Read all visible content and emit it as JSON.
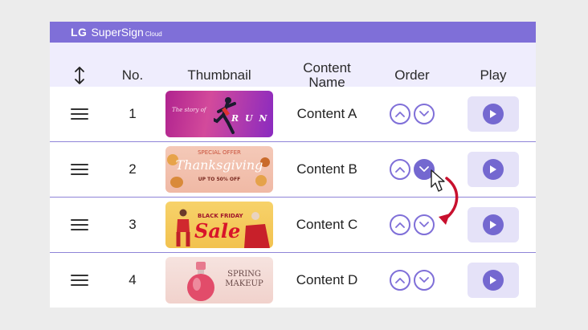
{
  "brand": {
    "logo": "LG",
    "name": "SuperSign",
    "suffix": "Cloud"
  },
  "table": {
    "headers": {
      "sort": "sort-arrows-icon",
      "no": "No.",
      "thumbnail": "Thumbnail",
      "content_name": "Content\nName",
      "order": "Order",
      "play": "Play"
    },
    "rows": [
      {
        "no": "1",
        "name": "Content A",
        "thumb": {
          "top": "The story of",
          "main": "R U N"
        }
      },
      {
        "no": "2",
        "name": "Content B",
        "thumb": {
          "top": "SPECIAL OFFER",
          "main": "Thanksgiving",
          "sub": "UP TO 50% OFF"
        }
      },
      {
        "no": "3",
        "name": "Content C",
        "thumb": {
          "top": "BLACK FRIDAY",
          "main": "Sale"
        }
      },
      {
        "no": "4",
        "name": "Content D",
        "thumb": {
          "top": "SPRING",
          "main": "MAKEUP"
        }
      }
    ]
  },
  "colors": {
    "accent": "#7f6fd8",
    "header_bg": "#efedfd",
    "play_bg": "#e5e2f8",
    "drag_arrow": "#c8102e"
  },
  "icons": [
    "drag-handle-icon",
    "chevron-up-icon",
    "chevron-down-icon",
    "play-icon",
    "mouse-cursor-icon",
    "curved-arrow-icon"
  ]
}
